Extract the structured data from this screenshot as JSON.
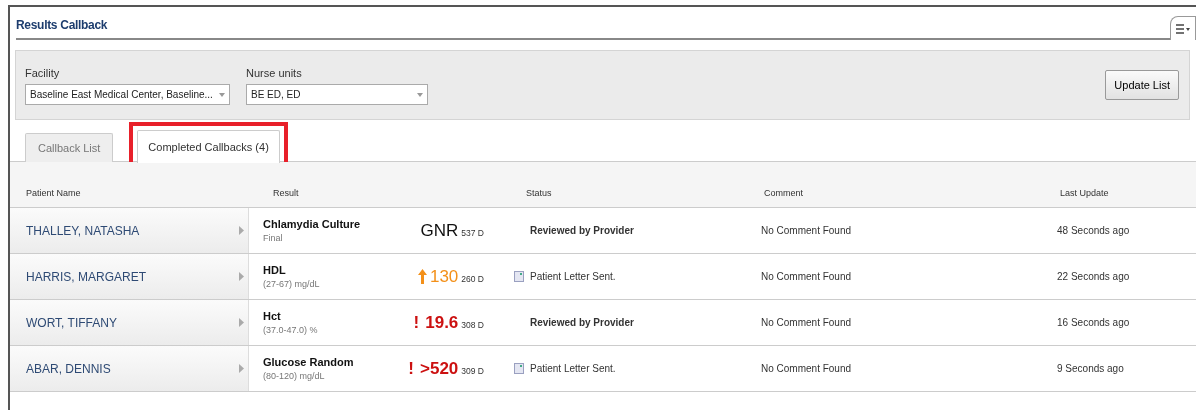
{
  "title": "Results Callback",
  "filters": [
    {
      "label": "Facility",
      "value": "Baseline East Medical Center, Baseline..."
    },
    {
      "label": "Nurse units",
      "value": "BE ED, ED"
    }
  ],
  "update_button": "Update List",
  "tabs": [
    {
      "label": "Callback List",
      "selected": false,
      "highlighted": false
    },
    {
      "label": "Completed Callbacks (4)",
      "selected": true,
      "highlighted": true
    }
  ],
  "columns": [
    "Patient Name",
    "Result",
    "Status",
    "Comment",
    "Last Update"
  ],
  "rows": [
    {
      "patient": "THALLEY, NATASHA",
      "result": "Chlamydia Culture",
      "detail": "Final",
      "kind": "normal",
      "value": "GNR",
      "age": "537 D",
      "status_bold": true,
      "letter_icon": false,
      "status": "Reviewed by Provider",
      "comment": "No Comment Found",
      "updated": "48 Seconds ago"
    },
    {
      "patient": "HARRIS, MARGARET",
      "result": "HDL",
      "detail": "(27-67) mg/dL",
      "kind": "high",
      "value": "130",
      "age": "260 D",
      "status_bold": false,
      "letter_icon": true,
      "status": "Patient Letter Sent.",
      "comment": "No Comment Found",
      "updated": "22 Seconds ago"
    },
    {
      "patient": "WORT, TIFFANY",
      "result": "Hct",
      "detail": "(37.0-47.0) %",
      "kind": "critical",
      "flag": "!",
      "value": "19.6",
      "age": "308 D",
      "status_bold": true,
      "letter_icon": false,
      "status": "Reviewed by Provider",
      "comment": "No Comment Found",
      "updated": "16 Seconds ago"
    },
    {
      "patient": "ABAR, DENNIS",
      "result": "Glucose Random",
      "detail": "(80-120) mg/dL",
      "kind": "critical",
      "flag": "!",
      "value": ">520",
      "age": "309 D",
      "status_bold": false,
      "letter_icon": true,
      "status": "Patient Letter Sent.",
      "comment": "No Comment Found",
      "updated": "9 Seconds ago"
    }
  ]
}
